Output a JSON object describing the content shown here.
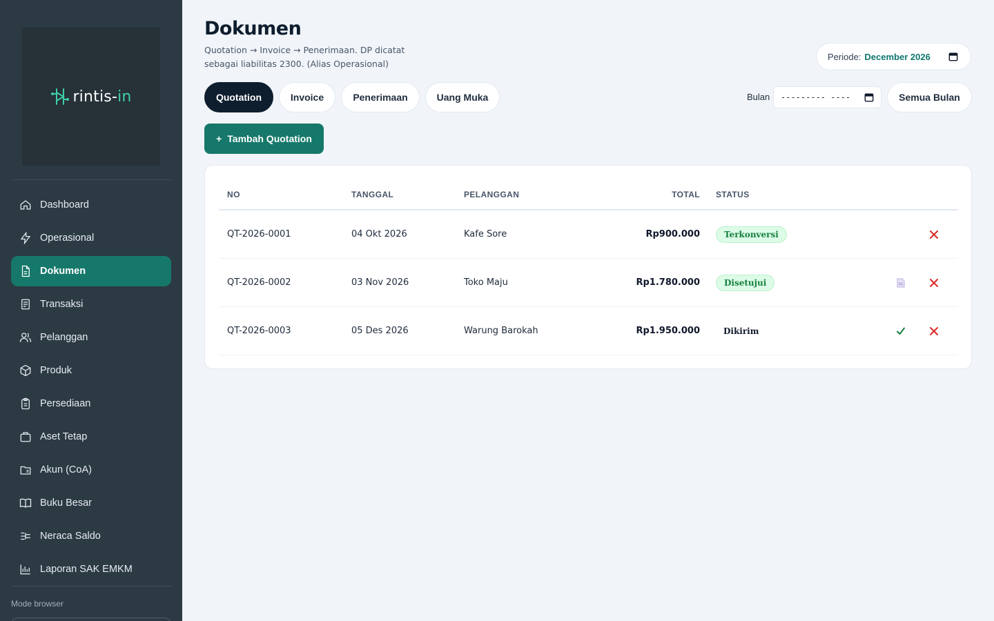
{
  "sidebar": {
    "brand": {
      "name_prefix": "rintis-",
      "name_accent": "in"
    },
    "items": [
      {
        "label": "Dashboard",
        "icon": "home-icon"
      },
      {
        "label": "Operasional",
        "icon": "bolt-icon"
      },
      {
        "label": "Dokumen",
        "icon": "document-icon",
        "active": true
      },
      {
        "label": "Transaksi",
        "icon": "receipt-icon"
      },
      {
        "label": "Pelanggan",
        "icon": "users-icon"
      },
      {
        "label": "Produk",
        "icon": "box-icon"
      },
      {
        "label": "Persediaan",
        "icon": "clipboard-icon"
      },
      {
        "label": "Aset Tetap",
        "icon": "briefcase-icon"
      },
      {
        "label": "Akun (CoA)",
        "icon": "folder-icon"
      },
      {
        "label": "Buku Besar",
        "icon": "book-icon"
      },
      {
        "label": "Neraca Saldo",
        "icon": "balance-icon"
      },
      {
        "label": "Laporan SAK EMKM",
        "icon": "chart-icon"
      }
    ],
    "mode_label": "Mode browser"
  },
  "header": {
    "title": "Dokumen",
    "subtitle": "Quotation → Invoice → Penerimaan. DP dicatat sebagai liabilitas 2300. (Alias Operasional)",
    "periode_label": "Periode:",
    "periode_value": "December 2026"
  },
  "tabs": [
    {
      "label": "Quotation",
      "active": true
    },
    {
      "label": "Invoice"
    },
    {
      "label": "Penerimaan"
    },
    {
      "label": "Uang Muka"
    }
  ],
  "filter": {
    "bulan_label": "Bulan",
    "bulan_value": "---------  ----",
    "semua_label": "Semua Bulan"
  },
  "add_button": {
    "label": "Tambah Quotation",
    "prefix": "+"
  },
  "table": {
    "columns": [
      "NO",
      "TANGGAL",
      "PELANGGAN",
      "TOTAL",
      "STATUS"
    ],
    "rows": [
      {
        "no": "QT-2026-0001",
        "tanggal": "04 Okt 2026",
        "pelanggan": "Kafe Sore",
        "total": "Rp900.000",
        "status": "Terkonversi",
        "status_style": "green",
        "actions": [
          "delete"
        ]
      },
      {
        "no": "QT-2026-0002",
        "tanggal": "03 Nov 2026",
        "pelanggan": "Toko Maju",
        "total": "Rp1.780.000",
        "status": "Disetujui",
        "status_style": "green",
        "actions": [
          "convert-document",
          "delete"
        ]
      },
      {
        "no": "QT-2026-0003",
        "tanggal": "05 Des 2026",
        "pelanggan": "Warung Barokah",
        "total": "Rp1.950.000",
        "status": "Dikirim",
        "status_style": "plain",
        "actions": [
          "approve",
          "delete"
        ]
      }
    ]
  },
  "colors": {
    "sidebar_bg": "#2c3a44",
    "accent": "#16786a",
    "brand_accent": "#3fd0a6",
    "badge_green_bg": "#dcfce7",
    "badge_green_text": "#15803d",
    "delete": "#dc2626",
    "approve": "#15803d"
  }
}
